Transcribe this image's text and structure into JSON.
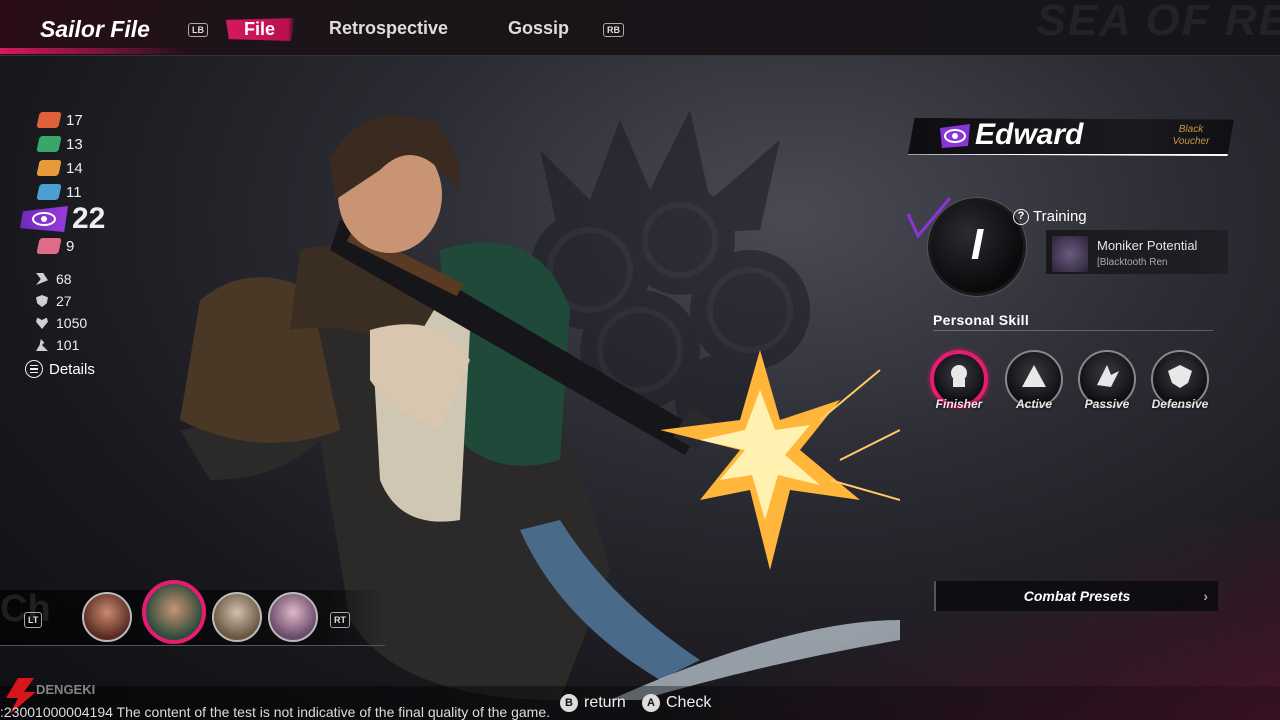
{
  "header": {
    "title": "Sailor File",
    "lb_hint": "LB",
    "rb_hint": "RB",
    "tabs": [
      {
        "label": "File",
        "active": true
      },
      {
        "label": "Retrospective",
        "active": false
      },
      {
        "label": "Gossip",
        "active": false
      }
    ],
    "watermark": "SEA OF RE"
  },
  "resources": [
    {
      "icon": "red-ticket-icon",
      "color": "#e0603a",
      "value": "17"
    },
    {
      "icon": "green-ticket-icon",
      "color": "#3aa76a",
      "value": "13"
    },
    {
      "icon": "orange-ticket-icon",
      "color": "#e89a3a",
      "value": "14"
    },
    {
      "icon": "blue-ticket-icon",
      "color": "#4aa0d0",
      "value": "11"
    },
    {
      "icon": "eye-emblem-icon",
      "color": "#8a35d8",
      "value": "22",
      "highlight": true
    },
    {
      "icon": "pink-lips-icon",
      "color": "#e06a8a",
      "value": "9"
    }
  ],
  "attributes": [
    {
      "icon": "claw-icon",
      "value": "68"
    },
    {
      "icon": "shield-icon",
      "value": "27"
    },
    {
      "icon": "heart-icon",
      "value": "1050"
    },
    {
      "icon": "speed-icon",
      "value": "101"
    }
  ],
  "details_label": "Details",
  "character": {
    "name": "Edward",
    "voucher": "Black Voucher",
    "rank": "I",
    "training_label": "Training",
    "moniker_title": "Moniker Potential",
    "moniker_sub": "[Blacktooth Ren"
  },
  "personal_skill_title": "Personal Skill",
  "skills": [
    {
      "label": "Finisher",
      "selected": true
    },
    {
      "label": "Active",
      "selected": false
    },
    {
      "label": "Passive",
      "selected": false
    },
    {
      "label": "Defensive",
      "selected": false
    }
  ],
  "combat_presets_label": "Combat Presets",
  "crew": {
    "lt_hint": "LT",
    "rt_hint": "RT",
    "ghost_text": "Ch"
  },
  "footer": {
    "note": ":23001000004194  The content of the test is not indicative of the final quality of the game.",
    "return_key": "B",
    "return_label": "return",
    "check_key": "A",
    "check_label": "Check",
    "logo_text": "DENGEKI"
  },
  "colors": {
    "accent": "#e81b72",
    "tab_active": "#d6195e",
    "purple": "#8a35d8",
    "voucher": "#c8963c"
  }
}
